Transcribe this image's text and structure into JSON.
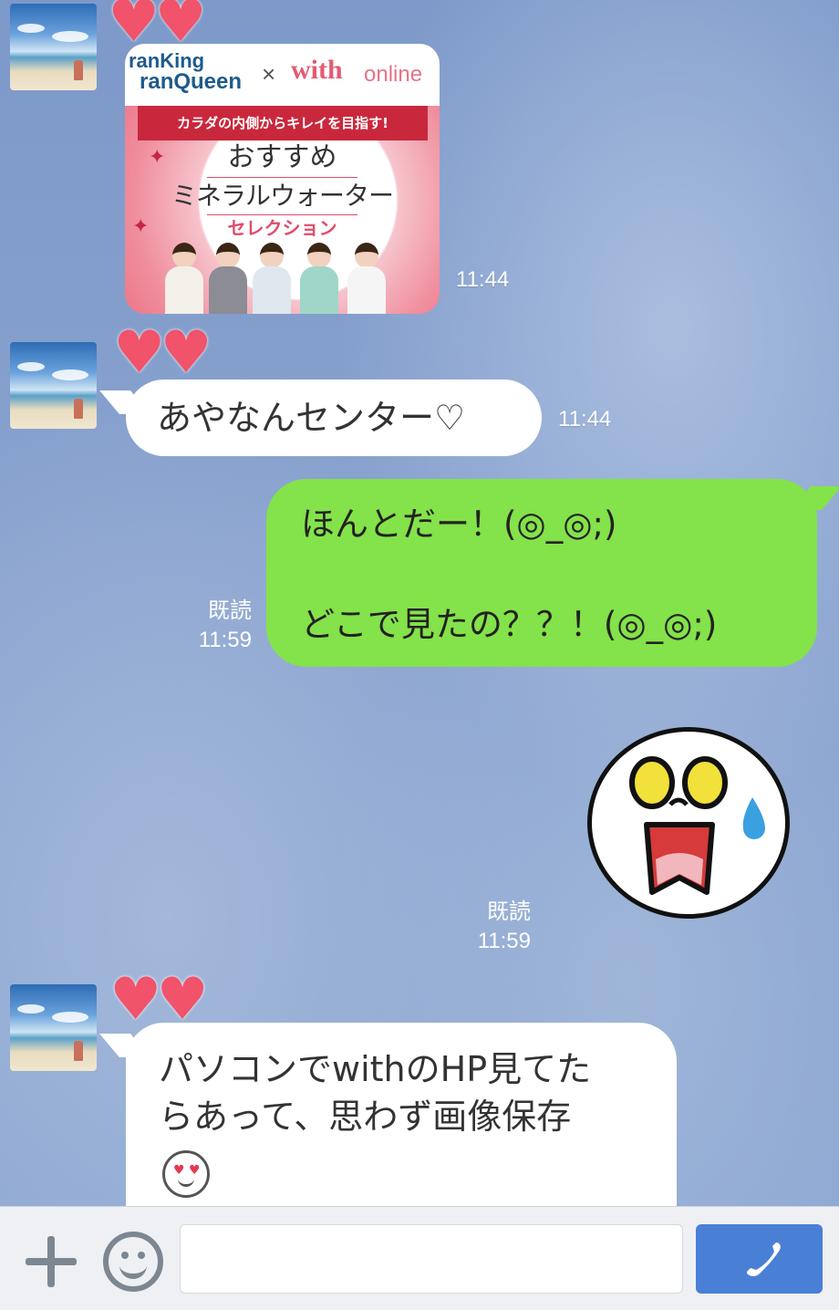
{
  "chat": {
    "messages": [
      {
        "sender": "other",
        "type": "image",
        "time": "11:44",
        "image": {
          "brand_line1": "ranKing",
          "brand_line2": "ranQueen",
          "separator": "×",
          "partner": "with",
          "partner_suffix": "online",
          "ribbon": "カラダの内側からキレイを目指す!",
          "title_line1": "おすすめ",
          "title_line2": "ミネラルウォーター",
          "title_line3": "セレクション"
        }
      },
      {
        "sender": "other",
        "type": "text",
        "time": "11:44",
        "text": "あやなんセンター♡"
      },
      {
        "sender": "me",
        "type": "text",
        "read": "既読",
        "time": "11:59",
        "line1": "ほんとだー！(◎_◎;)",
        "line2": "どこで見たの？？！(◎_◎;)"
      },
      {
        "sender": "me",
        "type": "sticker",
        "sticker": "shocked-face-sticker",
        "read": "既読",
        "time": "11:59"
      },
      {
        "sender": "other",
        "type": "text",
        "line1": "パソコンでwithのHP見てた",
        "line2": "らあって、思わず画像保存",
        "emoji": "😍"
      }
    ]
  },
  "decorations": {
    "hearts": "♥♥"
  },
  "input_bar": {
    "placeholder": ""
  },
  "icons": {
    "plus": "plus-icon",
    "emoji": "smile-icon",
    "call": "phone-icon"
  },
  "colors": {
    "background": "#8aa3cf",
    "my_bubble": "#84e24a",
    "their_bubble": "#ffffff",
    "call_button": "#4a7fd6",
    "heart": "#f0536a"
  }
}
